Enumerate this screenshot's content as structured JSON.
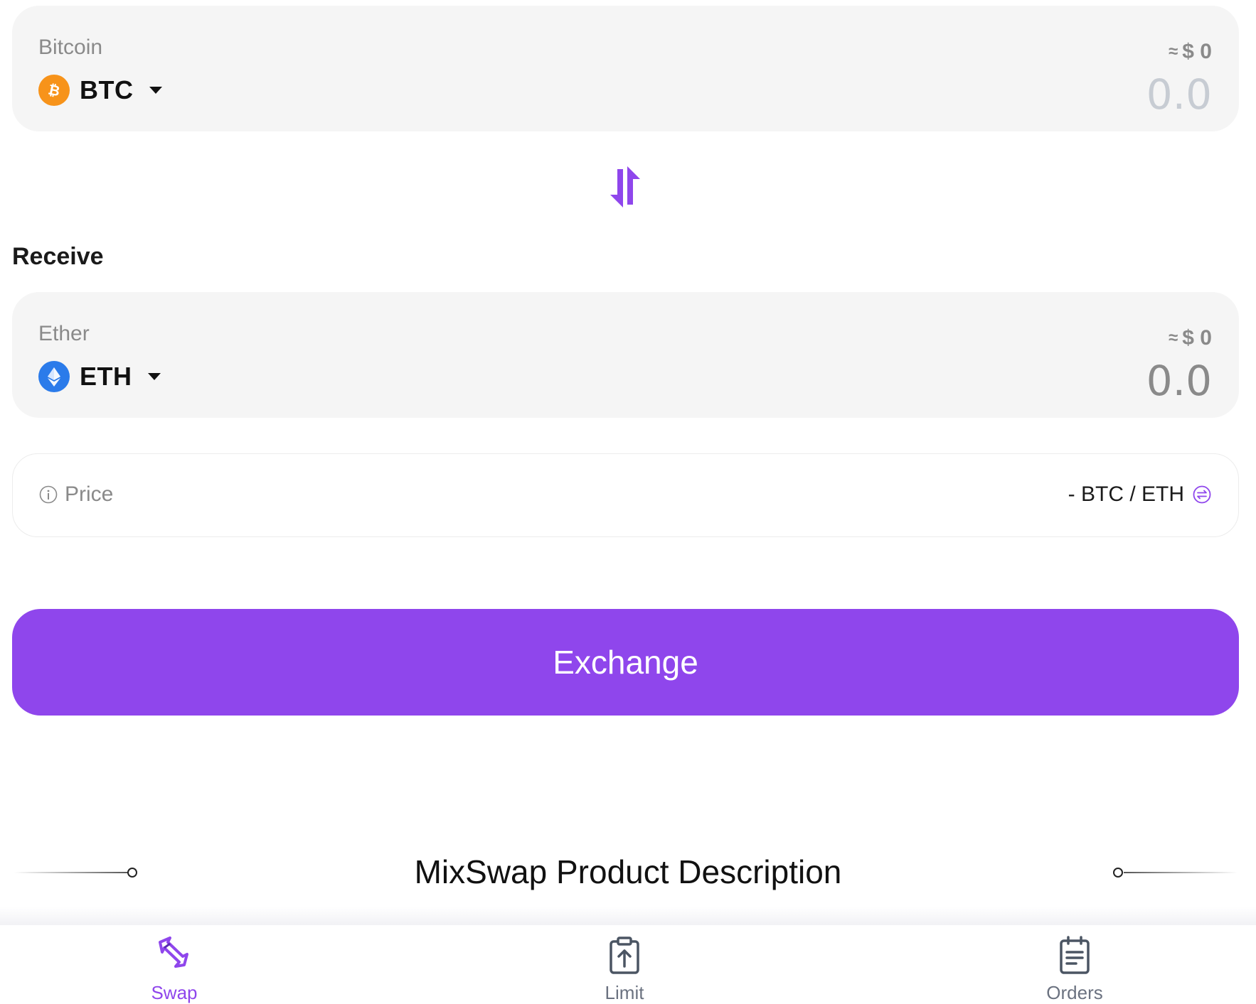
{
  "pay": {
    "token_name": "Bitcoin",
    "symbol": "BTC",
    "icon": "bitcoin-icon",
    "usd_approx_symbol": "≈",
    "usd_value": "$ 0",
    "amount_placeholder": "0.0"
  },
  "swap_button": {
    "icon": "swap-arrows-icon"
  },
  "receive": {
    "section_label": "Receive",
    "token_name": "Ether",
    "symbol": "ETH",
    "icon": "ethereum-icon",
    "usd_approx_symbol": "≈",
    "usd_value": "$ 0",
    "amount_value": "0.0"
  },
  "price": {
    "label": "Price",
    "value": "- BTC / ETH",
    "info_icon": "info-icon",
    "toggle_icon": "swap-rate-icon"
  },
  "exchange_button": {
    "label": "Exchange"
  },
  "description": {
    "heading": "MixSwap Product Description"
  },
  "bottom_nav": {
    "items": [
      {
        "label": "Swap",
        "icon": "swap-nav-icon",
        "active": true
      },
      {
        "label": "Limit",
        "icon": "limit-nav-icon",
        "active": false
      },
      {
        "label": "Orders",
        "icon": "orders-nav-icon",
        "active": false
      }
    ]
  },
  "colors": {
    "accent": "#8f46ec",
    "bitcoin": "#f7931a",
    "ethereum": "#2b7bea",
    "card_bg": "#f5f5f5",
    "muted_text": "#8a8a8a"
  }
}
